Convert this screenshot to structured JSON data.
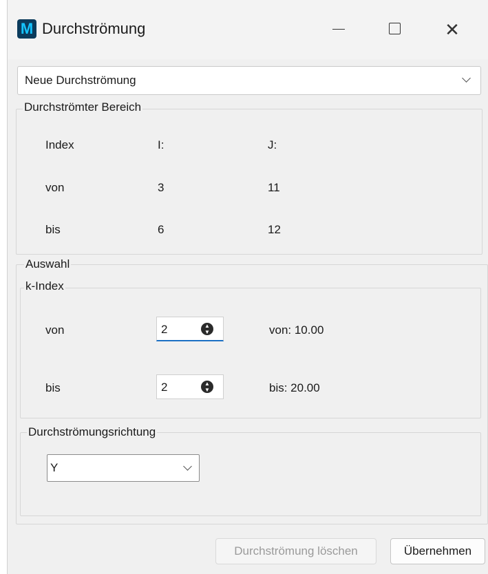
{
  "window": {
    "title": "Durchströmung",
    "app_icon_letter": "M",
    "minimize_glyph": "—",
    "maximize_glyph": "☐",
    "close_glyph": "✕"
  },
  "flow_select": {
    "value": "Neue Durchströmung"
  },
  "region": {
    "legend": "Durchströmter Bereich",
    "index_label": "Index",
    "i_header": "I:",
    "j_header": "J:",
    "from_label": "von",
    "to_label": "bis",
    "i_from": "3",
    "j_from": "11",
    "i_to": "6",
    "j_to": "12"
  },
  "selection": {
    "legend": "Auswahl",
    "k_index": {
      "legend": "k-Index",
      "from_label": "von",
      "to_label": "bis",
      "from_value": "2",
      "to_value": "2",
      "from_info": "von: 10.00",
      "to_info": "bis: 20.00"
    },
    "direction": {
      "legend": "Durchströmungsrichtung",
      "value": "Y"
    }
  },
  "buttons": {
    "delete_label": "Durchströmung löschen",
    "apply_label": "Übernehmen"
  },
  "colors": {
    "accent": "#1a6fc4",
    "window_bg": "#f0f0f0"
  }
}
